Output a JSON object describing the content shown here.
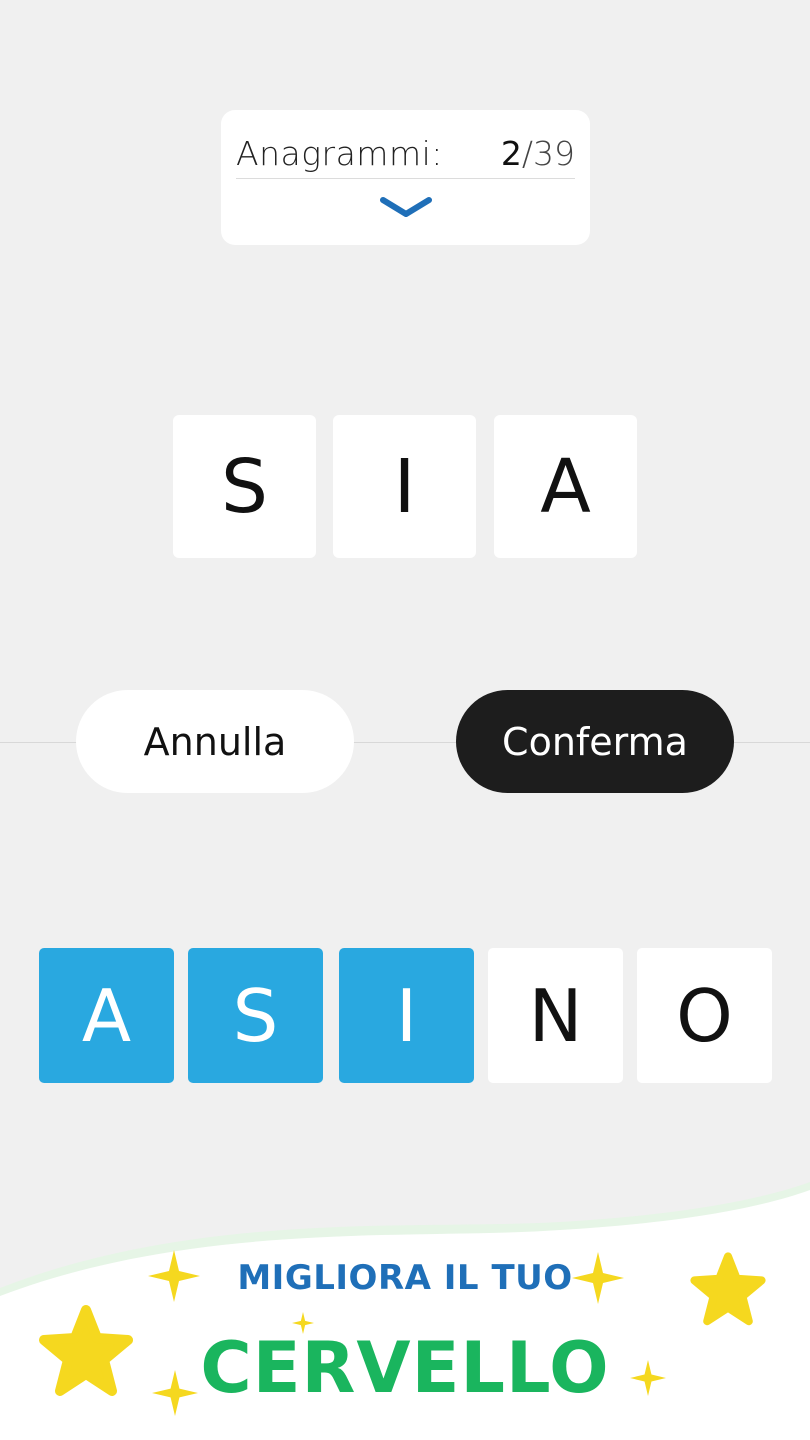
{
  "counter": {
    "label": "Anagrammi:",
    "current": "2",
    "separator": "/",
    "total": "39"
  },
  "answer_tiles": [
    "S",
    "I",
    "A"
  ],
  "buttons": {
    "cancel": "Annulla",
    "confirm": "Conferma"
  },
  "letter_tiles": [
    {
      "letter": "A",
      "selected": true
    },
    {
      "letter": "S",
      "selected": true
    },
    {
      "letter": "I",
      "selected": true
    },
    {
      "letter": "N",
      "selected": false
    },
    {
      "letter": "O",
      "selected": false
    }
  ],
  "banner": {
    "line1": "MIGLIORA IL TUO",
    "line2": "CERVELLO"
  },
  "colors": {
    "background": "#f0f0f0",
    "selected_tile": "#29a8e0",
    "confirm_button": "#1d1d1d",
    "chevron": "#1f6fb8",
    "banner_line1": "#1f6fb8",
    "banner_line2": "#1ab55e",
    "stars": "#f5d81f"
  },
  "icons": {
    "expand": "chevron-down-icon",
    "decoration": "star-icon"
  }
}
